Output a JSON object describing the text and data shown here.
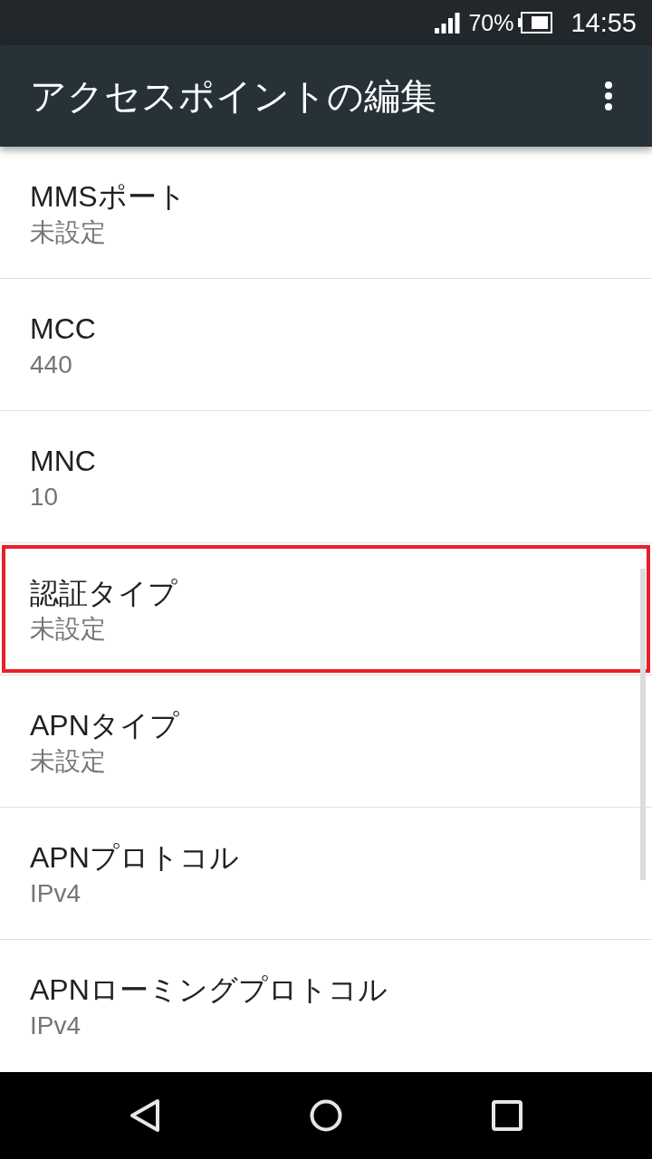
{
  "status_bar": {
    "battery_text": "70%",
    "time": "14:55"
  },
  "app_bar": {
    "title": "アクセスポイントの編集"
  },
  "settings": [
    {
      "title": "MMSポート",
      "value": "未設定",
      "highlighted": false
    },
    {
      "title": "MCC",
      "value": "440",
      "highlighted": false
    },
    {
      "title": "MNC",
      "value": "10",
      "highlighted": false
    },
    {
      "title": "認証タイプ",
      "value": "未設定",
      "highlighted": true
    },
    {
      "title": "APNタイプ",
      "value": "未設定",
      "highlighted": false
    },
    {
      "title": "APNプロトコル",
      "value": "IPv4",
      "highlighted": false
    },
    {
      "title": "APNローミングプロトコル",
      "value": "IPv4",
      "highlighted": false
    }
  ]
}
